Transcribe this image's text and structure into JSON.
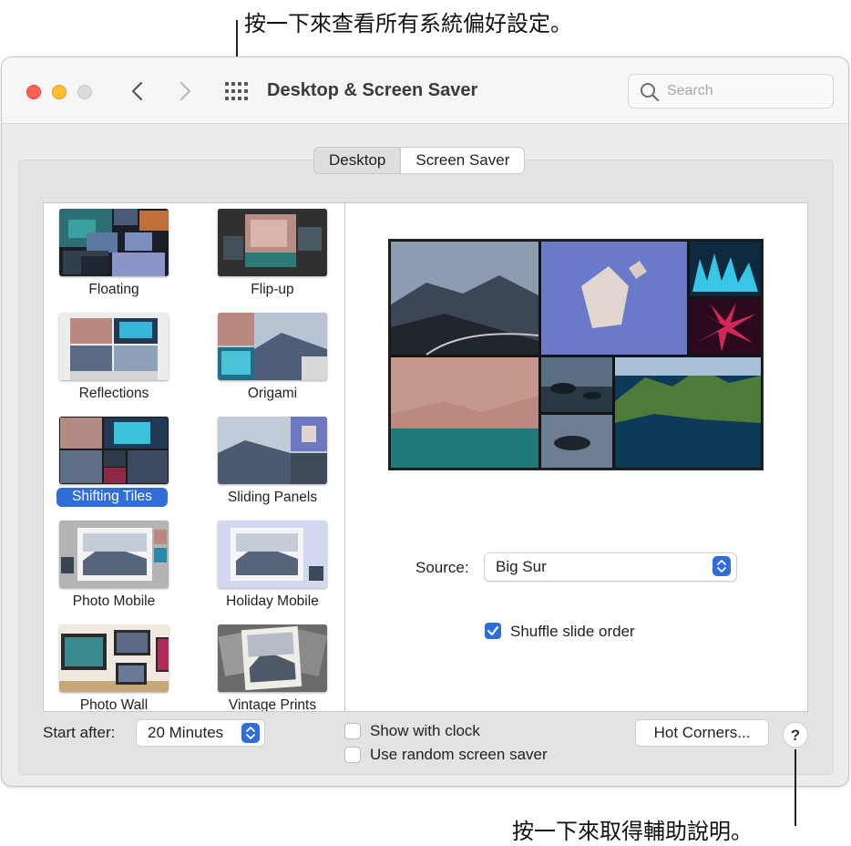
{
  "callouts": {
    "top": "按一下來查看所有系統偏好設定。",
    "bottom": "按一下來取得輔助說明。"
  },
  "window": {
    "title": "Desktop & Screen Saver",
    "search_placeholder": "Search"
  },
  "tabs": [
    {
      "label": "Desktop",
      "active": false
    },
    {
      "label": "Screen Saver",
      "active": true
    }
  ],
  "screen_savers": [
    {
      "label": "Floating",
      "selected": false
    },
    {
      "label": "Flip-up",
      "selected": false
    },
    {
      "label": "Reflections",
      "selected": false
    },
    {
      "label": "Origami",
      "selected": false
    },
    {
      "label": "Shifting Tiles",
      "selected": true
    },
    {
      "label": "Sliding Panels",
      "selected": false
    },
    {
      "label": "Photo Mobile",
      "selected": false
    },
    {
      "label": "Holiday Mobile",
      "selected": false
    },
    {
      "label": "Photo Wall",
      "selected": false
    },
    {
      "label": "Vintage Prints",
      "selected": false
    }
  ],
  "options": {
    "source_label": "Source:",
    "source_value": "Big Sur",
    "shuffle_label": "Shuffle slide order",
    "shuffle_checked": true
  },
  "bottom": {
    "start_after_label": "Start after:",
    "start_after_value": "20 Minutes",
    "show_clock_label": "Show with clock",
    "show_clock_checked": false,
    "random_label": "Use random screen saver",
    "random_checked": false,
    "hot_corners_label": "Hot Corners...",
    "help_label": "?"
  },
  "colors": {
    "accent": "#2f6ed8",
    "close": "#ff5f57",
    "minimize": "#febc2e"
  }
}
